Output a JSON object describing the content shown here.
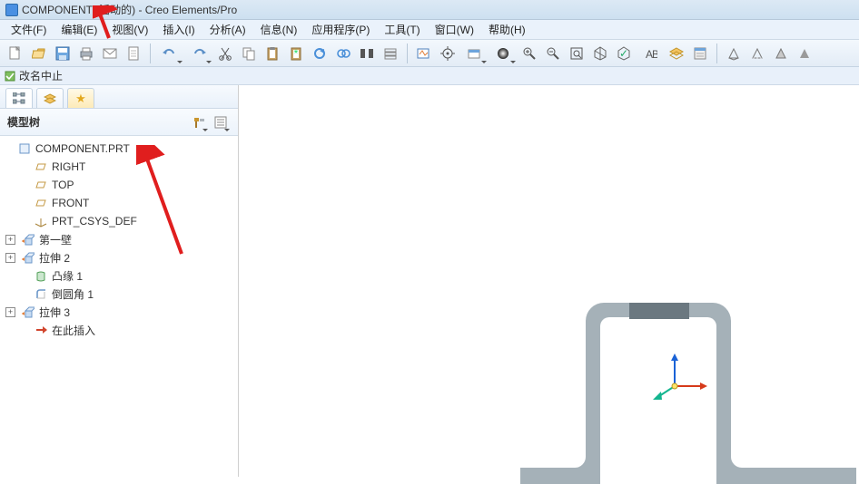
{
  "titlebar": {
    "title": "COMPONENT (活动的) - Creo Elements/Pro"
  },
  "menubar": {
    "items": [
      {
        "label": "文件(F)"
      },
      {
        "label": "编辑(E)"
      },
      {
        "label": "视图(V)"
      },
      {
        "label": "插入(I)"
      },
      {
        "label": "分析(A)"
      },
      {
        "label": "信息(N)"
      },
      {
        "label": "应用程序(P)"
      },
      {
        "label": "工具(T)"
      },
      {
        "label": "窗口(W)"
      },
      {
        "label": "帮助(H)"
      }
    ]
  },
  "status": {
    "text": "改名中止"
  },
  "sidebar": {
    "header_label": "模型树",
    "tree": [
      {
        "label": "COMPONENT.PRT",
        "icon": "part",
        "expander": "none",
        "indent": 0
      },
      {
        "label": "RIGHT",
        "icon": "datum-plane",
        "expander": "none",
        "indent": 1
      },
      {
        "label": "TOP",
        "icon": "datum-plane",
        "expander": "none",
        "indent": 1
      },
      {
        "label": "FRONT",
        "icon": "datum-plane",
        "expander": "none",
        "indent": 1
      },
      {
        "label": "PRT_CSYS_DEF",
        "icon": "csys",
        "expander": "none",
        "indent": 1
      },
      {
        "label": "第一壁",
        "icon": "extrude",
        "expander": "plus",
        "indent": 1
      },
      {
        "label": "拉伸 2",
        "icon": "extrude",
        "expander": "plus",
        "indent": 1
      },
      {
        "label": "凸缘 1",
        "icon": "flange",
        "expander": "none",
        "indent": 1
      },
      {
        "label": "倒圆角 1",
        "icon": "round",
        "expander": "none",
        "indent": 1
      },
      {
        "label": "拉伸 3",
        "icon": "extrude",
        "expander": "plus",
        "indent": 1
      },
      {
        "label": "在此插入",
        "icon": "insert-here",
        "expander": "none",
        "indent": 1
      }
    ]
  }
}
